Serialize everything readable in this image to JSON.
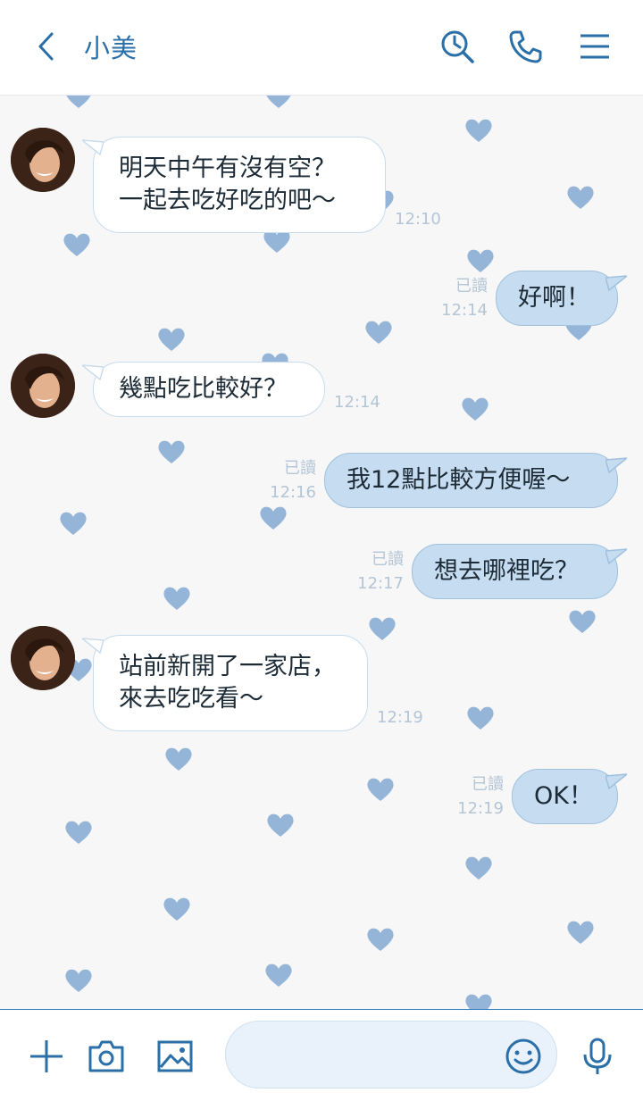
{
  "colors": {
    "accent": "#2a6fa8",
    "heart": "#94b4d8",
    "out_bubble": "#c6dcf0",
    "meta": "#b4c5d6"
  },
  "header": {
    "back_icon": "chevron-left-icon",
    "title": "小美",
    "icons": [
      "search-history-icon",
      "phone-icon",
      "menu-icon"
    ]
  },
  "messages": [
    {
      "side": "in",
      "lines": [
        "明天中午有沒有空？",
        "一起去吃好吃的吧～"
      ],
      "time": "12:10"
    },
    {
      "side": "out",
      "lines": [
        "好啊！"
      ],
      "read": "已讀",
      "time": "12:14"
    },
    {
      "side": "in",
      "lines": [
        "幾點吃比較好？"
      ],
      "time": "12:14"
    },
    {
      "side": "out",
      "lines": [
        "我12點比較方便喔～"
      ],
      "read": "已讀",
      "time": "12:16"
    },
    {
      "side": "out",
      "lines": [
        "想去哪裡吃？"
      ],
      "read": "已讀",
      "time": "12:17"
    },
    {
      "side": "in",
      "lines": [
        "站前新開了一家店，",
        "來去吃吃看～"
      ],
      "time": "12:19"
    },
    {
      "side": "out",
      "lines": [
        "OK！"
      ],
      "read": "已讀",
      "time": "12:19"
    }
  ],
  "footer": {
    "icons": [
      "plus-icon",
      "camera-icon",
      "image-icon",
      "emoji-icon",
      "microphone-icon"
    ],
    "input_value": ""
  }
}
